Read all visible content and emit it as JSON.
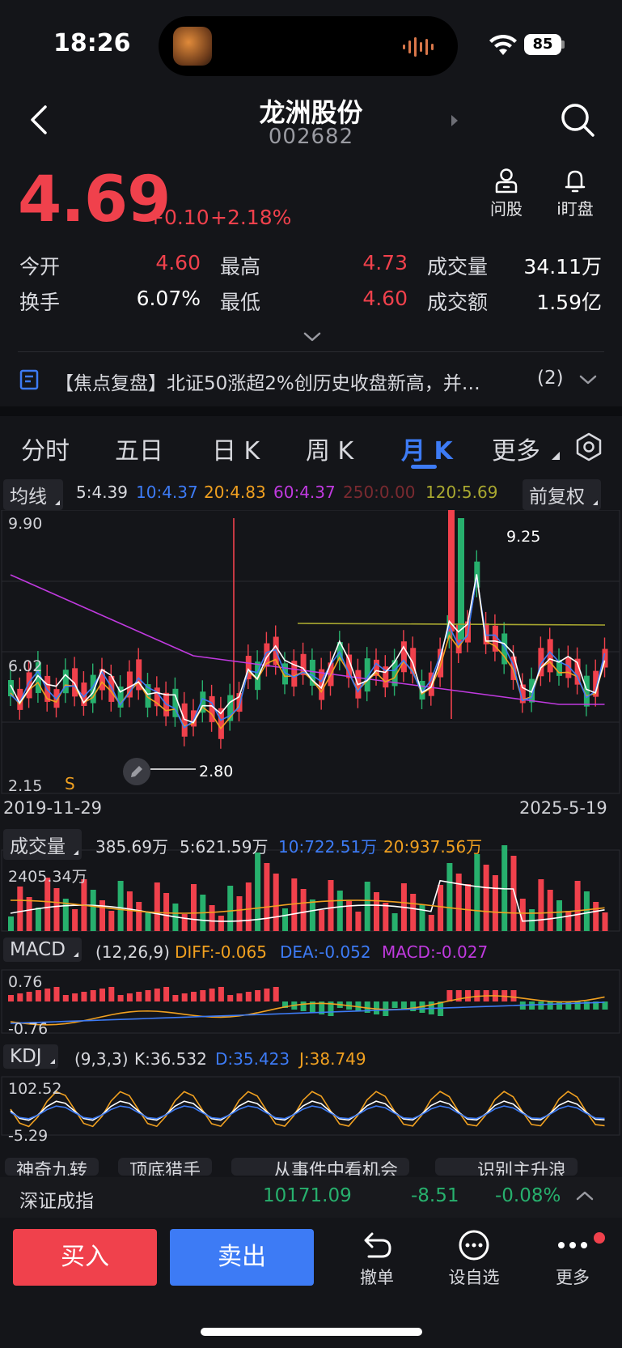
{
  "status": {
    "time": "18:26",
    "battery": "85"
  },
  "header": {
    "name": "龙洲股份",
    "code": "002682"
  },
  "price": {
    "last": "4.69",
    "change": "+0.10",
    "change_pct": "+2.18%"
  },
  "actions_top": {
    "ask": "问股",
    "watch": "i盯盘"
  },
  "quote": {
    "open_label": "今开",
    "open": "4.60",
    "high_label": "最高",
    "high": "4.73",
    "volume_label": "成交量",
    "volume": "34.11万",
    "turnover_label": "换手",
    "turnover": "6.07%",
    "low_label": "最低",
    "low": "4.60",
    "amount_label": "成交额",
    "amount": "1.59亿"
  },
  "news": {
    "text": "【焦点复盘】北证50涨超2%创历史收盘新高，并…",
    "count": "(2)"
  },
  "tabs": [
    "分时",
    "五日",
    "日 K",
    "周 K",
    "月 K",
    "更多"
  ],
  "active_tab": "月 K",
  "ma_row": {
    "chip": "均线",
    "ma5": "5:4.39",
    "ma10": "10:4.37",
    "ma20": "20:4.83",
    "ma60": "60:4.37",
    "ma250": "250:0.00",
    "ma120": "120:5.69",
    "adjust": "前复权"
  },
  "kline": {
    "y_top": "9.90",
    "y_mid": "6.02",
    "y_bottom": "2.15",
    "max_marker": "9.25",
    "min_marker": "2.80",
    "signal": "S",
    "date_start": "2019-11-29",
    "date_end": "2025-5-19"
  },
  "volume": {
    "chip": "成交量",
    "current": "385.69万",
    "ma5": "5:621.59万",
    "ma10": "10:722.51万",
    "ma20": "20:937.56万",
    "y_top": "2405.34万"
  },
  "macd": {
    "chip": "MACD",
    "params": "(12,26,9)",
    "diff": "DIFF:-0.065",
    "dea": "DEA:-0.052",
    "macd": "MACD:-0.027",
    "y_top": "0.76",
    "y_bottom": "-0.76"
  },
  "kdj": {
    "chip": "KDJ",
    "params": "(9,3,3)",
    "k": "K:36.532",
    "d": "D:35.423",
    "j": "J:38.749",
    "y_top": "102.52",
    "y_bottom": "-5.29"
  },
  "pills": [
    "神奇九转",
    "顶底猎手",
    "从事件中看机会",
    "识别主升浪"
  ],
  "index": {
    "name": "深证成指",
    "value": "10171.09",
    "change": "-8.51",
    "pct": "-0.08%"
  },
  "bottom": {
    "buy": "买入",
    "sell": "卖出",
    "cancel": "撤单",
    "watchlist": "设自选",
    "more": "更多"
  },
  "colors": {
    "up": "#f0414c",
    "down": "#27b06d",
    "accent": "#3d7bf5",
    "ma5": "#ffffff",
    "ma10": "#3d7bf5",
    "ma20": "#f0a020",
    "ma60": "#c03adf",
    "ma120": "#a9a830"
  }
}
